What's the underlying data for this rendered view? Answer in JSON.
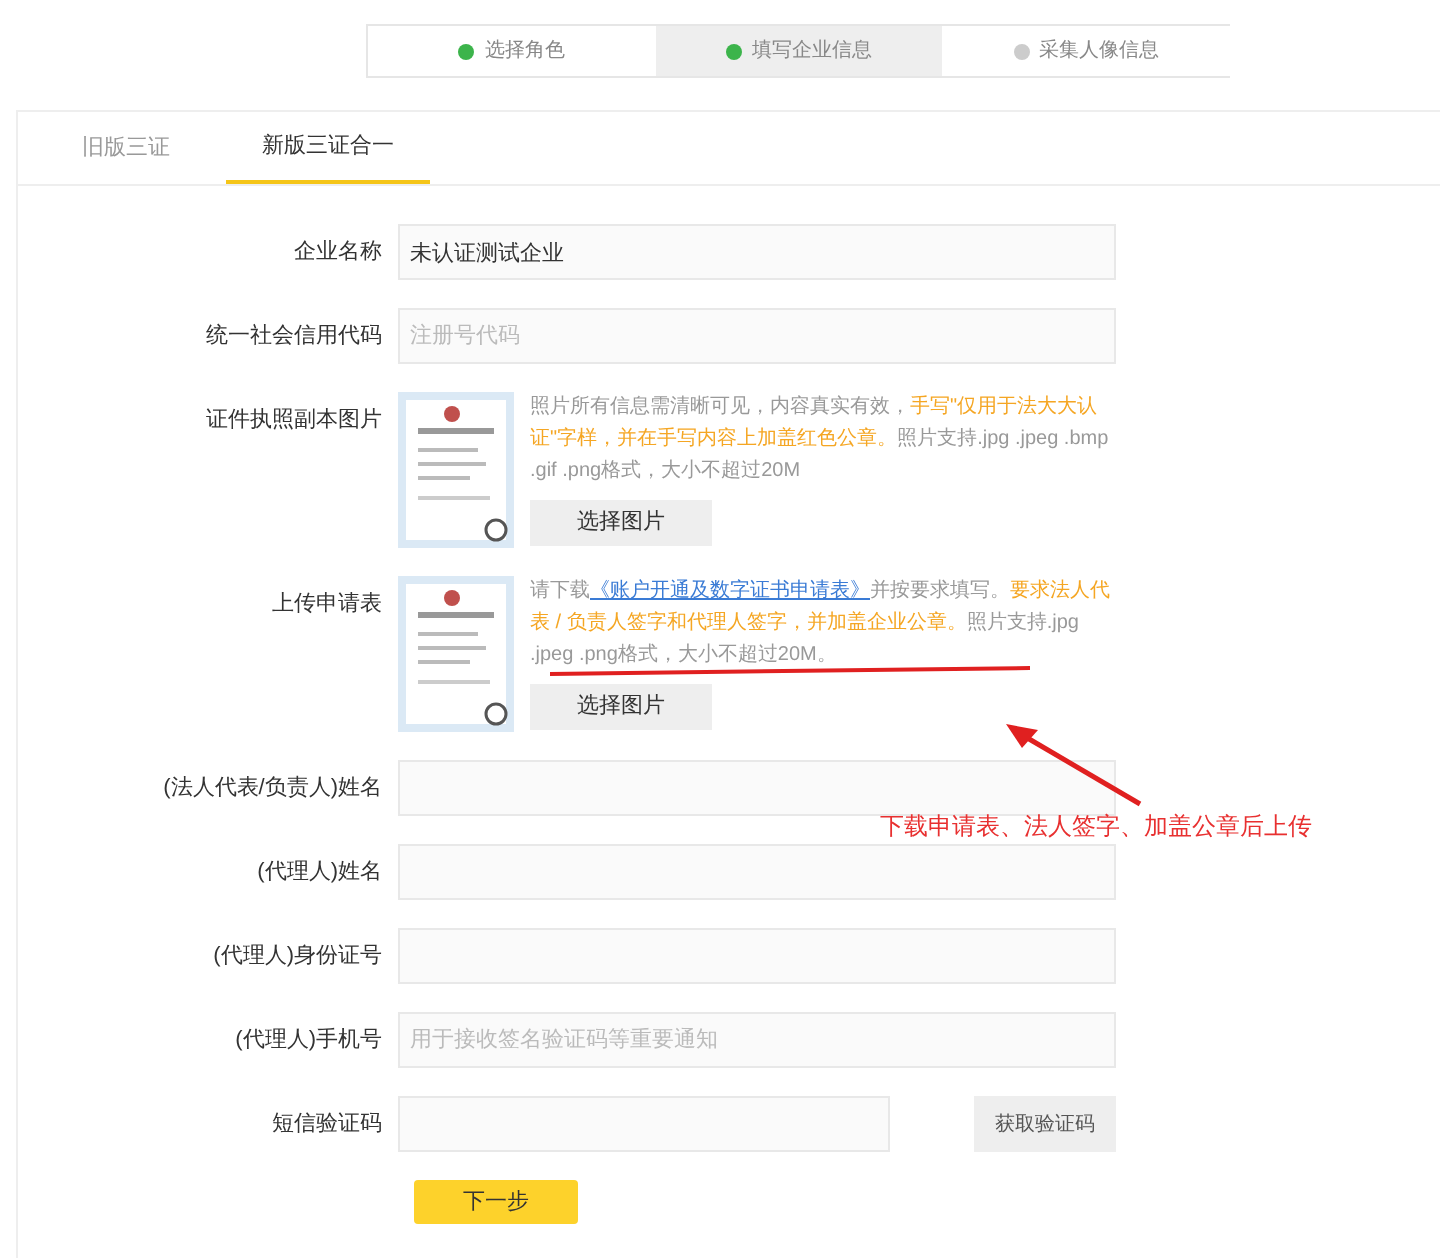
{
  "steps": [
    {
      "label": "选择角色",
      "done": true,
      "selected": false
    },
    {
      "label": "填写企业信息",
      "done": true,
      "selected": true
    },
    {
      "label": "采集人像信息",
      "done": false,
      "selected": false
    }
  ],
  "tabs": [
    {
      "label": "旧版三证",
      "selected": false
    },
    {
      "label": "新版三证合一",
      "selected": true
    }
  ],
  "form": [
    {
      "kind": "input",
      "label": "企业名称",
      "value": "未认证测试企业"
    },
    {
      "kind": "input",
      "label": "统一社会信用代码",
      "placeholder": "注册号代码"
    },
    {
      "kind": "upload",
      "label": "证件执照副本图片",
      "note": [
        {
          "text": "照片所有信息需清晰可见，内容真实有效，",
          "kind": "plain"
        },
        {
          "text": "手写\"仅用于法大大认证\"字样，并在手写内容上加盖红色公章。",
          "kind": "highlight"
        },
        {
          "text": "照片支持.jpg .jpeg .bmp .gif .png格式，大小不超过20M",
          "kind": "plain"
        }
      ],
      "button": "选择图片"
    },
    {
      "kind": "upload",
      "label": "上传申请表",
      "note": [
        {
          "text": "请下载",
          "kind": "plain"
        },
        {
          "text": "《账户开通及数字证书申请表》",
          "kind": "link"
        },
        {
          "text": "并按要求填写。",
          "kind": "plain"
        },
        {
          "text": "要求法人代表 / 负责人签字和代理人签字，并加盖企业公章。",
          "kind": "highlight"
        },
        {
          "text": "照片支持.jpg .jpeg .png格式，大小不超过20M。",
          "kind": "plain"
        }
      ],
      "button": "选择图片"
    },
    {
      "kind": "input",
      "label": "(法人代表/负责人)姓名"
    },
    {
      "kind": "input",
      "label": "(代理人)姓名"
    },
    {
      "kind": "input",
      "label": "(代理人)身份证号"
    },
    {
      "kind": "input",
      "label": "(代理人)手机号",
      "placeholder": "用于接收签名验证码等重要通知"
    },
    {
      "kind": "code",
      "label": "短信验证码",
      "button": "获取验证码"
    }
  ],
  "submit": "下一步",
  "annotation": "下载申请表、法人签字、加盖公章后上传"
}
